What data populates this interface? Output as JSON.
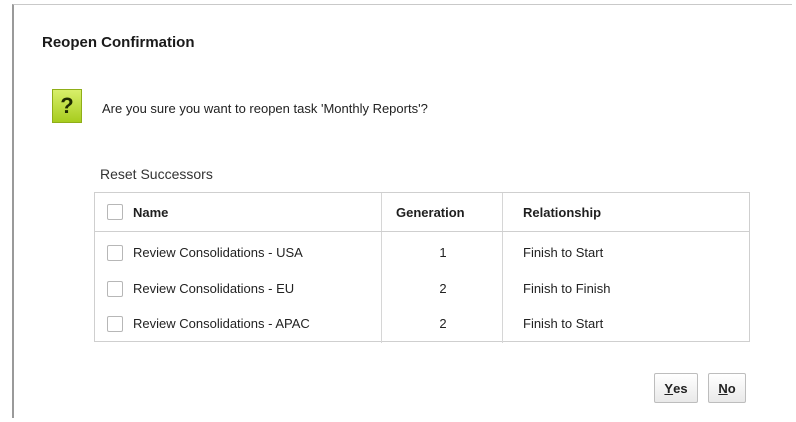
{
  "dialog": {
    "title": "Reopen Confirmation",
    "icon": "question-icon",
    "question": "Are you sure you want to reopen task 'Monthly Reports'?",
    "section_label": "Reset Successors"
  },
  "table": {
    "columns": [
      "Name",
      "Generation",
      "Relationship"
    ],
    "rows": [
      {
        "name": "Review Consolidations - USA",
        "generation": "1",
        "relationship": "Finish to Start"
      },
      {
        "name": "Review Consolidations - EU",
        "generation": "2",
        "relationship": "Finish to Finish"
      },
      {
        "name": "Review Consolidations - APAC",
        "generation": "2",
        "relationship": "Finish to Start"
      }
    ]
  },
  "buttons": {
    "yes": {
      "mnemonic": "Y",
      "rest": "es"
    },
    "no": {
      "mnemonic": "N",
      "rest": "o"
    }
  }
}
